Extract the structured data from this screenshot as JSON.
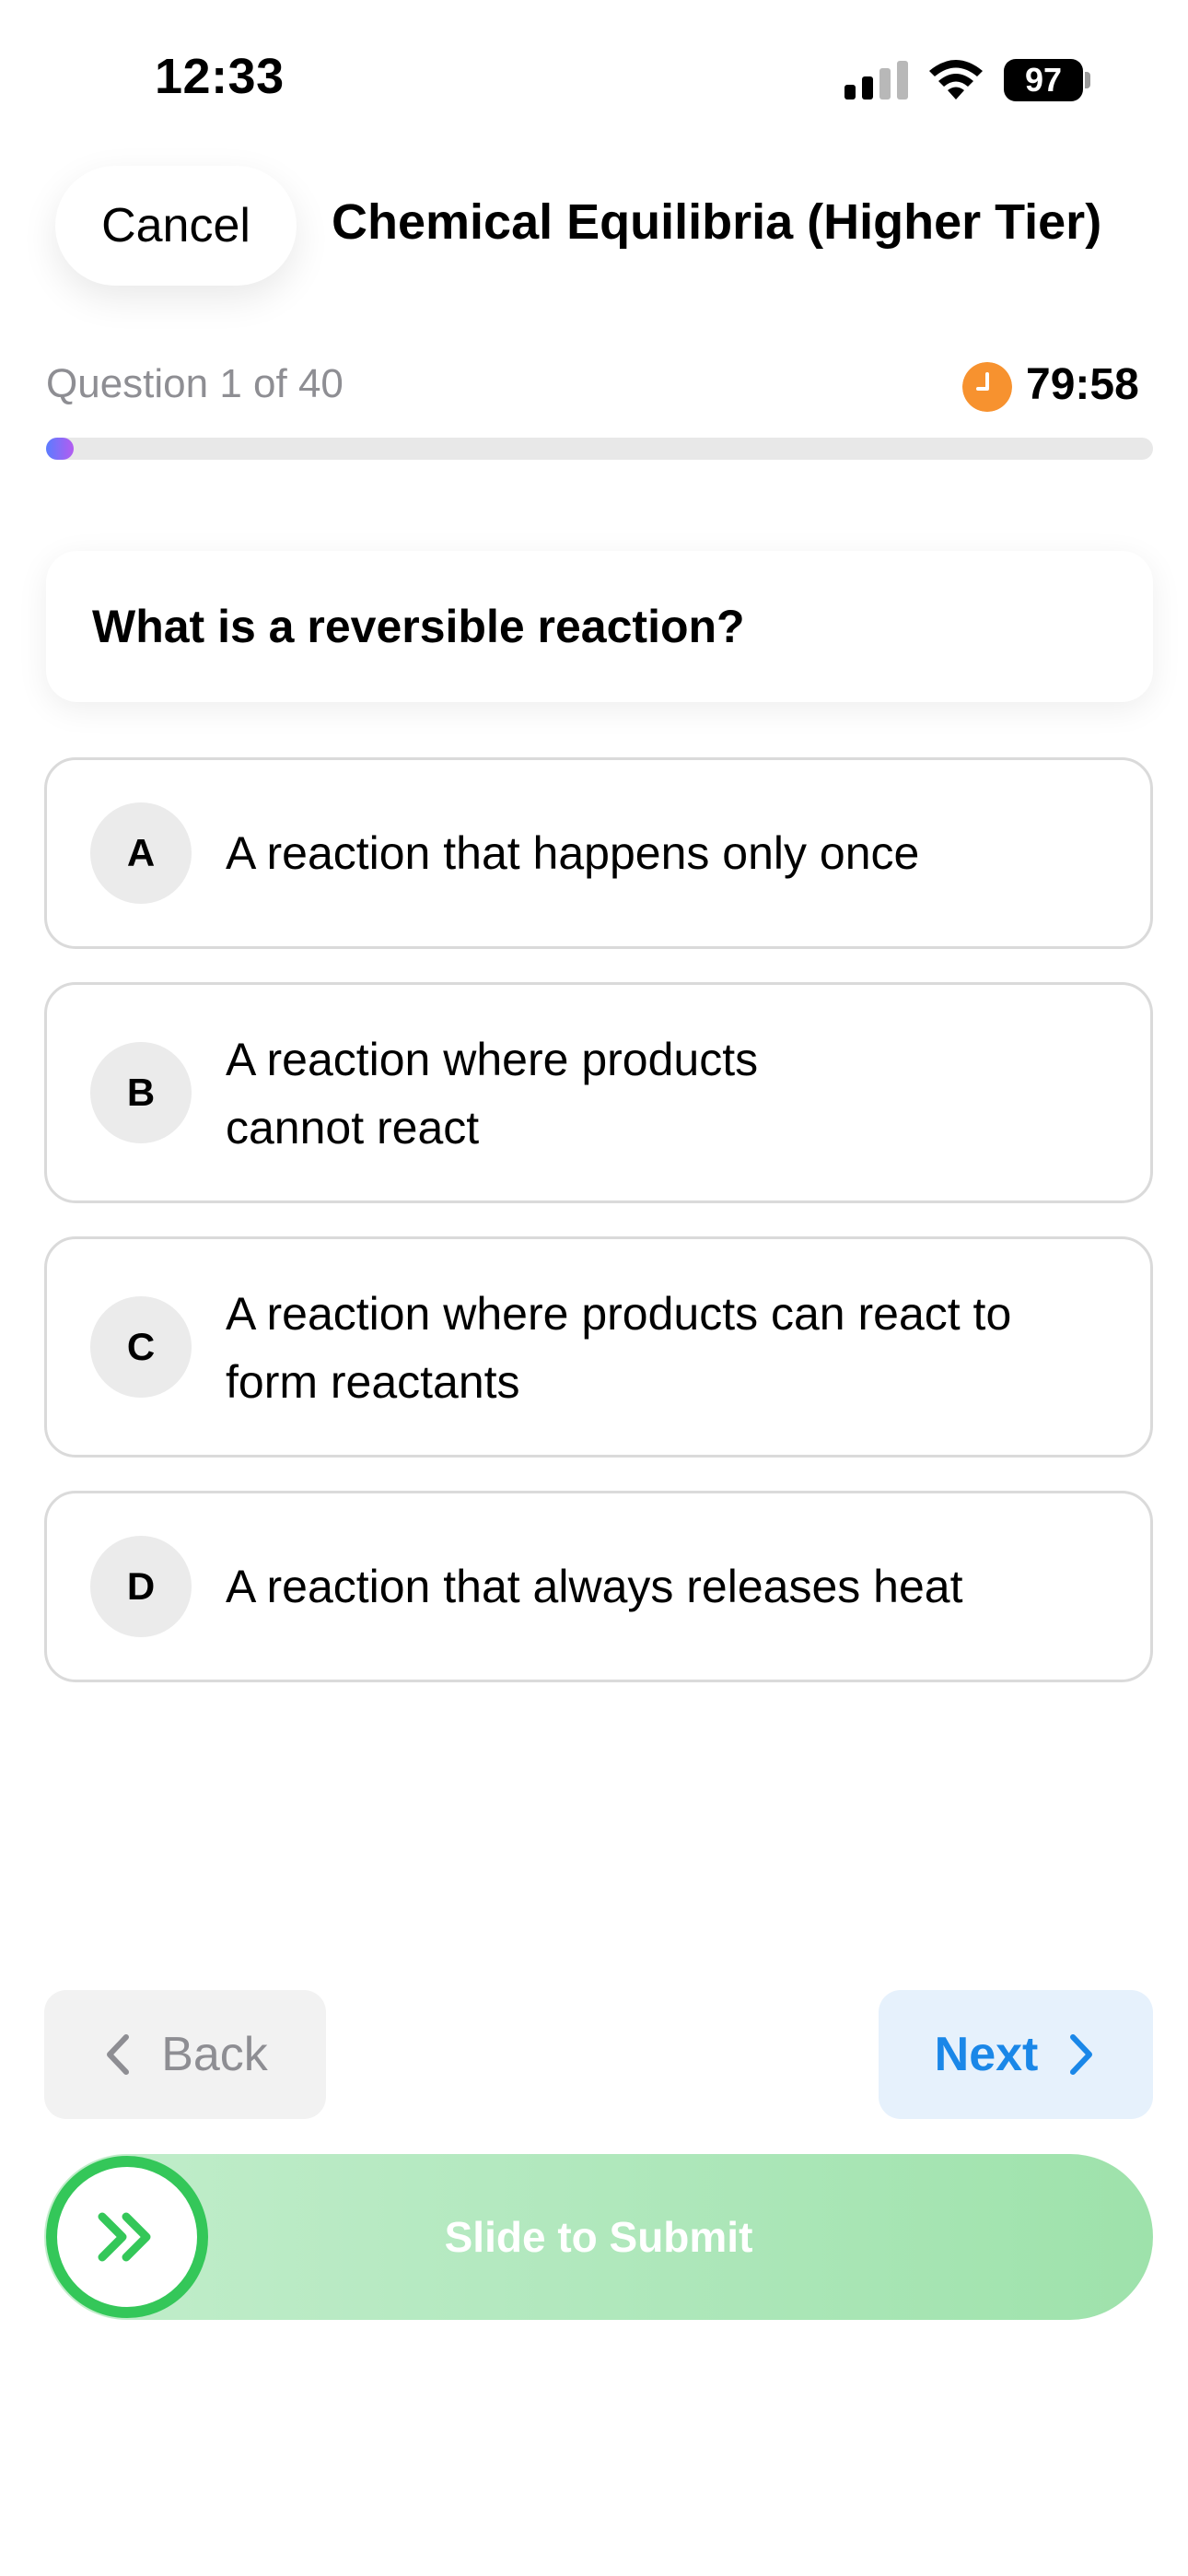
{
  "status_bar": {
    "time": "12:33",
    "battery": "97"
  },
  "header": {
    "cancel_label": "Cancel",
    "title": "Chemical Equilibria (Higher Tier)"
  },
  "progress": {
    "counter": "Question 1 of 40",
    "timer": "79:58",
    "fraction": 0.025
  },
  "question": {
    "text": "What is a reversible reaction?"
  },
  "options": [
    {
      "letter": "A",
      "text": "A reaction that happens only once"
    },
    {
      "letter": "B",
      "text": "A reaction where products cannot react"
    },
    {
      "letter": "C",
      "text": "A reaction where products can react to form reactants"
    },
    {
      "letter": "D",
      "text": "A reaction that always releases heat"
    }
  ],
  "navigation": {
    "back_label": "Back",
    "next_label": "Next"
  },
  "submit": {
    "label": "Slide to Submit"
  },
  "colors": {
    "accent_blue": "#1a87e8",
    "submit_green": "#34c759",
    "timer_orange": "#f7922f",
    "progress_gradient_start": "#5b7cff",
    "progress_gradient_end": "#b45cf0"
  },
  "icons": {
    "clock": "clock-icon",
    "back": "chevron-left-icon",
    "next": "chevron-right-icon",
    "slide": "double-chevron-right-icon"
  }
}
